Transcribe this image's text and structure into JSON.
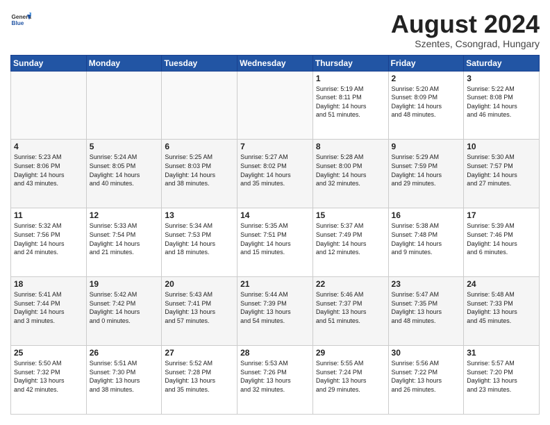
{
  "header": {
    "logo_general": "General",
    "logo_blue": "Blue",
    "month_year": "August 2024",
    "location": "Szentes, Csongrad, Hungary"
  },
  "weekdays": [
    "Sunday",
    "Monday",
    "Tuesday",
    "Wednesday",
    "Thursday",
    "Friday",
    "Saturday"
  ],
  "weeks": [
    [
      {
        "day": "",
        "info": ""
      },
      {
        "day": "",
        "info": ""
      },
      {
        "day": "",
        "info": ""
      },
      {
        "day": "",
        "info": ""
      },
      {
        "day": "1",
        "info": "Sunrise: 5:19 AM\nSunset: 8:11 PM\nDaylight: 14 hours\nand 51 minutes."
      },
      {
        "day": "2",
        "info": "Sunrise: 5:20 AM\nSunset: 8:09 PM\nDaylight: 14 hours\nand 48 minutes."
      },
      {
        "day": "3",
        "info": "Sunrise: 5:22 AM\nSunset: 8:08 PM\nDaylight: 14 hours\nand 46 minutes."
      }
    ],
    [
      {
        "day": "4",
        "info": "Sunrise: 5:23 AM\nSunset: 8:06 PM\nDaylight: 14 hours\nand 43 minutes."
      },
      {
        "day": "5",
        "info": "Sunrise: 5:24 AM\nSunset: 8:05 PM\nDaylight: 14 hours\nand 40 minutes."
      },
      {
        "day": "6",
        "info": "Sunrise: 5:25 AM\nSunset: 8:03 PM\nDaylight: 14 hours\nand 38 minutes."
      },
      {
        "day": "7",
        "info": "Sunrise: 5:27 AM\nSunset: 8:02 PM\nDaylight: 14 hours\nand 35 minutes."
      },
      {
        "day": "8",
        "info": "Sunrise: 5:28 AM\nSunset: 8:00 PM\nDaylight: 14 hours\nand 32 minutes."
      },
      {
        "day": "9",
        "info": "Sunrise: 5:29 AM\nSunset: 7:59 PM\nDaylight: 14 hours\nand 29 minutes."
      },
      {
        "day": "10",
        "info": "Sunrise: 5:30 AM\nSunset: 7:57 PM\nDaylight: 14 hours\nand 27 minutes."
      }
    ],
    [
      {
        "day": "11",
        "info": "Sunrise: 5:32 AM\nSunset: 7:56 PM\nDaylight: 14 hours\nand 24 minutes."
      },
      {
        "day": "12",
        "info": "Sunrise: 5:33 AM\nSunset: 7:54 PM\nDaylight: 14 hours\nand 21 minutes."
      },
      {
        "day": "13",
        "info": "Sunrise: 5:34 AM\nSunset: 7:53 PM\nDaylight: 14 hours\nand 18 minutes."
      },
      {
        "day": "14",
        "info": "Sunrise: 5:35 AM\nSunset: 7:51 PM\nDaylight: 14 hours\nand 15 minutes."
      },
      {
        "day": "15",
        "info": "Sunrise: 5:37 AM\nSunset: 7:49 PM\nDaylight: 14 hours\nand 12 minutes."
      },
      {
        "day": "16",
        "info": "Sunrise: 5:38 AM\nSunset: 7:48 PM\nDaylight: 14 hours\nand 9 minutes."
      },
      {
        "day": "17",
        "info": "Sunrise: 5:39 AM\nSunset: 7:46 PM\nDaylight: 14 hours\nand 6 minutes."
      }
    ],
    [
      {
        "day": "18",
        "info": "Sunrise: 5:41 AM\nSunset: 7:44 PM\nDaylight: 14 hours\nand 3 minutes."
      },
      {
        "day": "19",
        "info": "Sunrise: 5:42 AM\nSunset: 7:42 PM\nDaylight: 14 hours\nand 0 minutes."
      },
      {
        "day": "20",
        "info": "Sunrise: 5:43 AM\nSunset: 7:41 PM\nDaylight: 13 hours\nand 57 minutes."
      },
      {
        "day": "21",
        "info": "Sunrise: 5:44 AM\nSunset: 7:39 PM\nDaylight: 13 hours\nand 54 minutes."
      },
      {
        "day": "22",
        "info": "Sunrise: 5:46 AM\nSunset: 7:37 PM\nDaylight: 13 hours\nand 51 minutes."
      },
      {
        "day": "23",
        "info": "Sunrise: 5:47 AM\nSunset: 7:35 PM\nDaylight: 13 hours\nand 48 minutes."
      },
      {
        "day": "24",
        "info": "Sunrise: 5:48 AM\nSunset: 7:33 PM\nDaylight: 13 hours\nand 45 minutes."
      }
    ],
    [
      {
        "day": "25",
        "info": "Sunrise: 5:50 AM\nSunset: 7:32 PM\nDaylight: 13 hours\nand 42 minutes."
      },
      {
        "day": "26",
        "info": "Sunrise: 5:51 AM\nSunset: 7:30 PM\nDaylight: 13 hours\nand 38 minutes."
      },
      {
        "day": "27",
        "info": "Sunrise: 5:52 AM\nSunset: 7:28 PM\nDaylight: 13 hours\nand 35 minutes."
      },
      {
        "day": "28",
        "info": "Sunrise: 5:53 AM\nSunset: 7:26 PM\nDaylight: 13 hours\nand 32 minutes."
      },
      {
        "day": "29",
        "info": "Sunrise: 5:55 AM\nSunset: 7:24 PM\nDaylight: 13 hours\nand 29 minutes."
      },
      {
        "day": "30",
        "info": "Sunrise: 5:56 AM\nSunset: 7:22 PM\nDaylight: 13 hours\nand 26 minutes."
      },
      {
        "day": "31",
        "info": "Sunrise: 5:57 AM\nSunset: 7:20 PM\nDaylight: 13 hours\nand 23 minutes."
      }
    ]
  ]
}
